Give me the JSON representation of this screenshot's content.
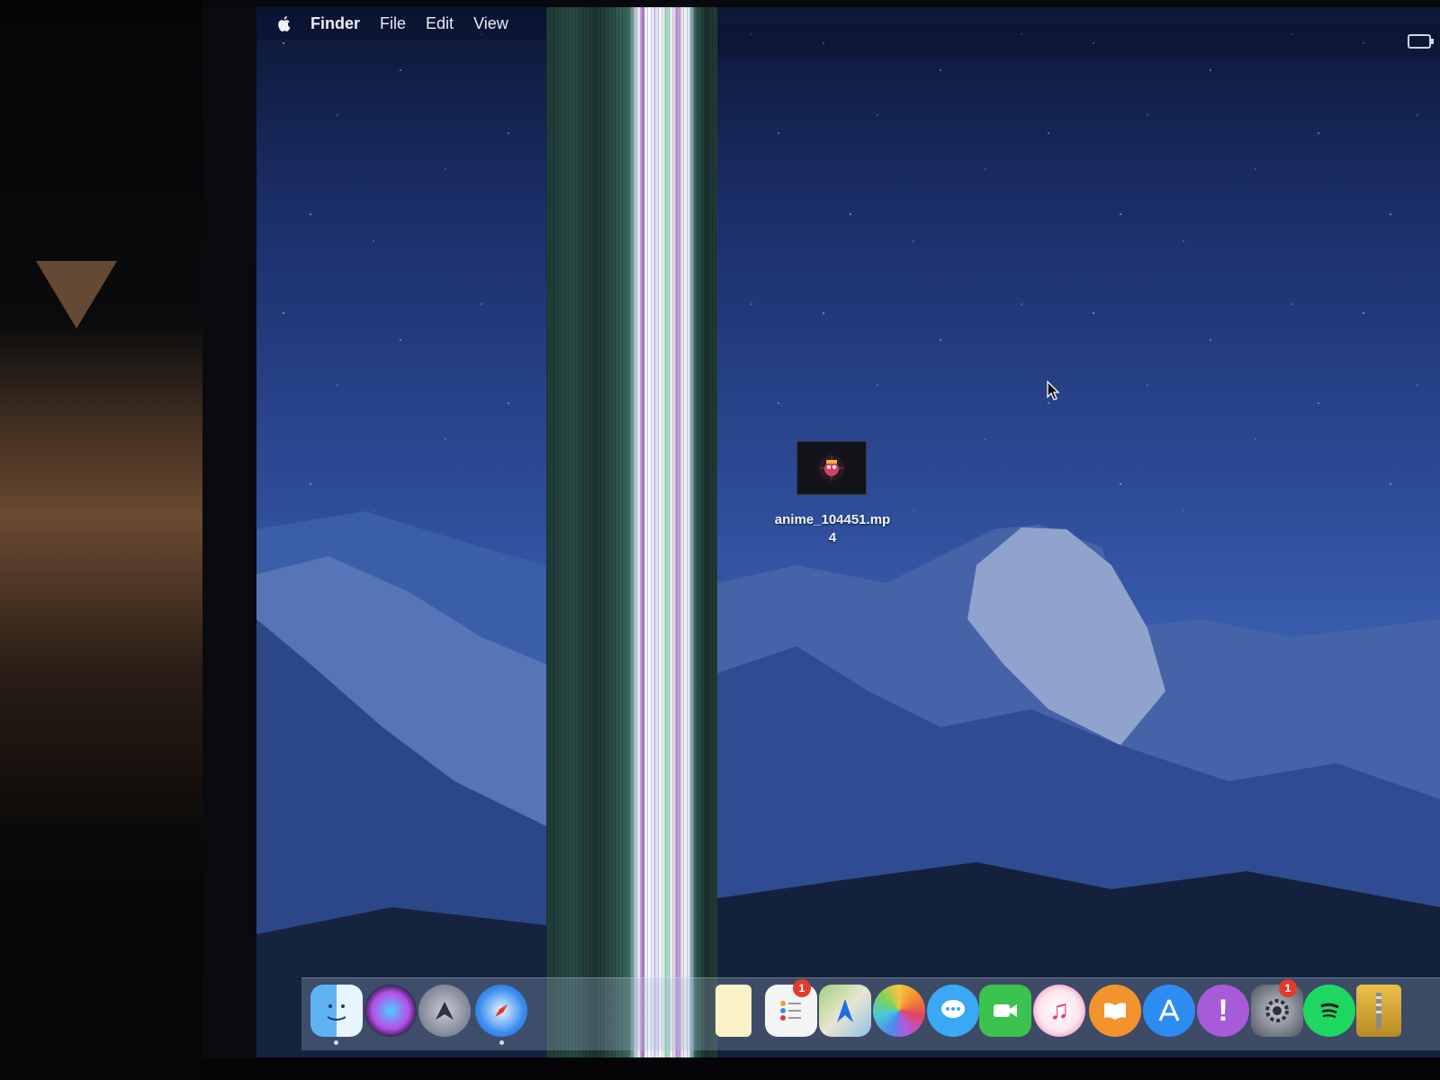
{
  "menubar": {
    "apple_icon": "apple-logo-icon",
    "app_name": "Finder",
    "items": [
      "File",
      "Edit",
      "View"
    ]
  },
  "desktop": {
    "file": {
      "name_line1": "anime_104451.mp",
      "name_line2": "4",
      "icon": "video-file-thumbnail-icon"
    }
  },
  "status": {
    "battery_icon": "battery-charging-icon"
  },
  "dock": {
    "items": [
      {
        "name": "finder-icon"
      },
      {
        "name": "siri-icon"
      },
      {
        "name": "launchpad-icon"
      },
      {
        "name": "safari-icon"
      },
      {
        "name": "notes-icon"
      },
      {
        "name": "reminders-icon",
        "badge": "1"
      },
      {
        "name": "maps-icon"
      },
      {
        "name": "photos-icon"
      },
      {
        "name": "messages-icon"
      },
      {
        "name": "facetime-icon"
      },
      {
        "name": "itunes-icon"
      },
      {
        "name": "ibooks-icon"
      },
      {
        "name": "app-store-icon"
      },
      {
        "name": "feedback-assistant-icon"
      },
      {
        "name": "system-preferences-icon",
        "badge": "1"
      },
      {
        "name": "spotify-icon"
      },
      {
        "name": "archive-utility-icon"
      }
    ]
  },
  "colors": {
    "accent_red": "#e23b2e",
    "wallpaper_blue": "#2c4a95"
  }
}
